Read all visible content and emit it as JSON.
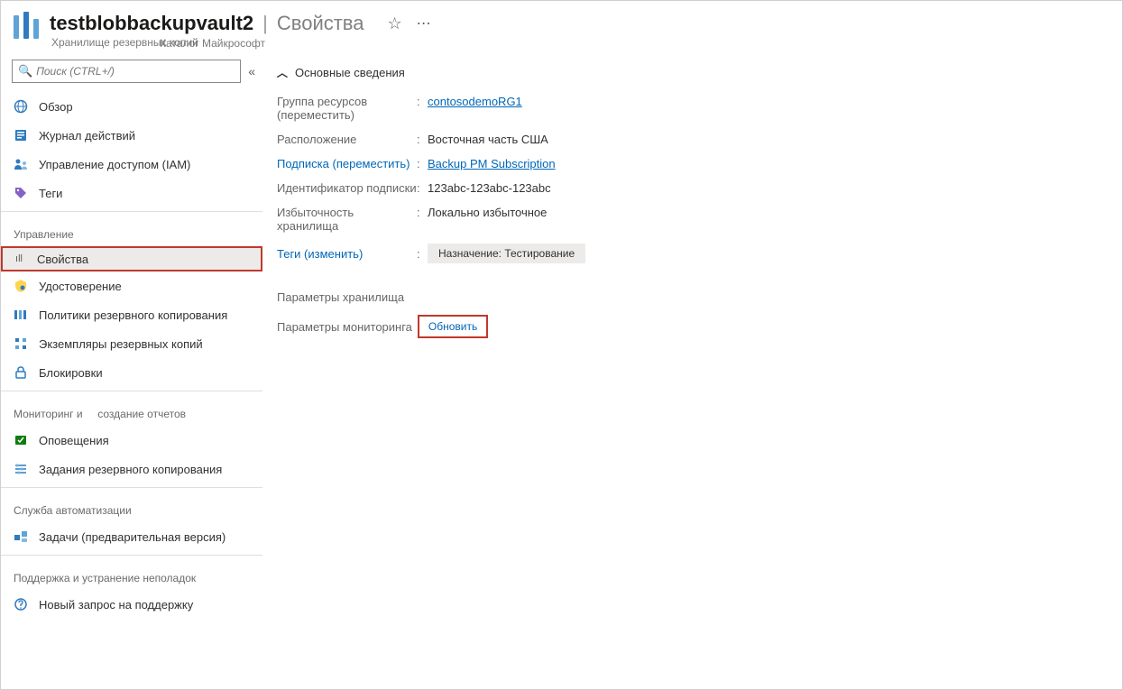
{
  "header": {
    "resource_name": "testblobbackupvault2",
    "page_title": "Свойства",
    "subtitle1": "Хранилище резервных копий",
    "subtitle2": "Каталог Майкрософт"
  },
  "sidebar": {
    "search_placeholder": "Поиск (CTRL+/)",
    "items_top": [
      {
        "label": "Обзор",
        "icon": "globe"
      },
      {
        "label": "Журнал действий",
        "icon": "log"
      },
      {
        "label": "Управление доступом (IAM)",
        "icon": "iam"
      },
      {
        "label": "Теги",
        "icon": "tag"
      }
    ],
    "section_manage": "Управление",
    "items_manage": [
      {
        "label": "Свойства",
        "icon": "props",
        "selected": true,
        "highlighted": true
      },
      {
        "label": "Удостоверение",
        "icon": "identity"
      },
      {
        "label": "Политики резервного копирования",
        "icon": "policies"
      },
      {
        "label": "Экземпляры резервных копий",
        "icon": "instances"
      },
      {
        "label": "Блокировки",
        "icon": "locks"
      }
    ],
    "section_monitor": "Мониторинг и     создание отчетов",
    "items_monitor": [
      {
        "label": "Оповещения",
        "icon": "alerts"
      },
      {
        "label": "Задания резервного копирования",
        "icon": "jobs"
      }
    ],
    "section_automation": "Служба автоматизации",
    "items_automation": [
      {
        "label": "Задачи (предварительная версия)",
        "icon": "tasks"
      }
    ],
    "section_support": "Поддержка и устранение неполадок",
    "items_support": [
      {
        "label": "Новый запрос на поддержку",
        "icon": "support"
      }
    ]
  },
  "main": {
    "essentials_title": "Основные сведения",
    "rows": {
      "rg_label": "Группа ресурсов (переместить)",
      "rg_value": "contosodemoRG1",
      "loc_label": "Расположение",
      "loc_value": "Восточная часть США",
      "sub_label": "Подписка (переместить)",
      "sub_value": "Backup PM Subscription",
      "subid_label": "Идентификатор подписки",
      "subid_value": "123abc-123abc-123abc",
      "red_label": "Избыточность хранилища",
      "red_value": "Локально избыточное",
      "tags_label": "Теги (изменить)",
      "tags_value": "Назначение: Тестирование"
    },
    "vault_settings_label": "Параметры хранилища",
    "monitoring_label": "Параметры мониторинга",
    "update_button": "Обновить"
  }
}
